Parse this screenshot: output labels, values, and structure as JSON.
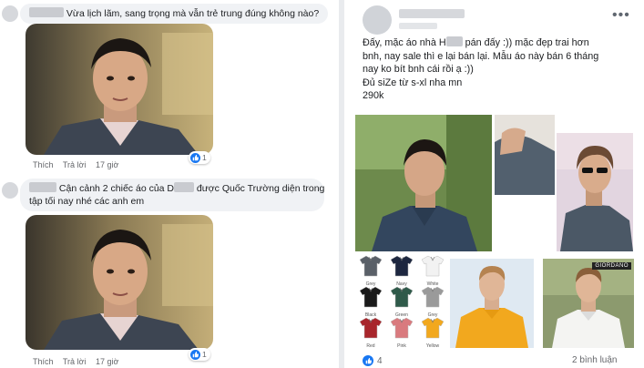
{
  "comments": [
    {
      "text_blurred_prefix": "",
      "text": "Vừa lịch lãm, sang trọng mà vẫn trẻ trung đúng không nào?",
      "actions": {
        "like": "Thích",
        "reply": "Trả lời",
        "time": "17 giờ"
      },
      "reactions": "1"
    },
    {
      "line1_a": "Cận cảnh 2 chiếc áo của D",
      "line1_b": " được Quốc Trường diện trong",
      "line2": "tập tối nay nhé các anh em",
      "actions": {
        "like": "Thích",
        "reply": "Trả lời",
        "time": "17 giờ"
      },
      "reactions": "1"
    }
  ],
  "post": {
    "more_label": "•••",
    "text_lines": [
      {
        "a": "Đấy, mặc áo nhà H",
        "b": " pán đấy :)) mặc đẹp trai hơn"
      },
      {
        "a": "bnh, nay sale thì e lại bán lại. Mẫu áo này bán 6 tháng"
      },
      {
        "a": "nay ko bít bnh cái rồi ạ :))"
      },
      {
        "a": "Đủ siZe từ s-xl nha mn"
      },
      {
        "a": "290k"
      }
    ],
    "brand_tag": "GIORDANO",
    "swatches": [
      {
        "label": "Grey",
        "color": "#5a6068"
      },
      {
        "label": "Navy",
        "color": "#1d2740"
      },
      {
        "label": "White",
        "color": "#f2f2f2"
      },
      {
        "label": "Black",
        "color": "#1a1a1a"
      },
      {
        "label": "Green",
        "color": "#2f5a4a"
      },
      {
        "label": "Grey",
        "color": "#9a9a9a"
      },
      {
        "label": "Red",
        "color": "#a8262c"
      },
      {
        "label": "Pink",
        "color": "#d97a7e"
      },
      {
        "label": "Yellow",
        "color": "#f2a81e"
      }
    ],
    "likes": "4",
    "comments_count": "2 bình luận"
  },
  "colors": {
    "like_blue": "#1877f2",
    "bubble_bg": "#f0f2f5",
    "divider": "#e9ebee"
  }
}
